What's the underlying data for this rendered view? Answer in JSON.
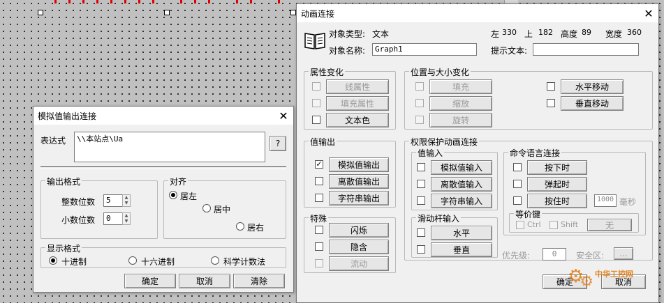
{
  "anim": {
    "title": "动画连接",
    "obj_type_label": "对象类型:",
    "obj_type": "文本",
    "left_label": "左",
    "left": "330",
    "top_label": "上",
    "top": "182",
    "height_label": "高度",
    "height": "89",
    "width_label": "宽度",
    "width": "360",
    "obj_name_label": "对象名称:",
    "obj_name": "Graph1",
    "hint_label": "提示文本:",
    "hint": "",
    "attr_group": "属性变化",
    "line_attr": "线属性",
    "fill_attr": "填充属性",
    "text_color": "文本色",
    "pos_group": "位置与大小变化",
    "fill": "填充",
    "scale": "缩放",
    "rotate": "旋转",
    "hmove": "水平移动",
    "vmove": "垂直移动",
    "valout_group": "值输出",
    "analog_out": "模拟值输出",
    "discrete_out": "离散值输出",
    "string_out": "字符串输出",
    "perm_group": "权限保护动画连接",
    "valin_group": "值输入",
    "analog_in": "模拟值输入",
    "discrete_in": "离散值输入",
    "string_in": "字符串输入",
    "slider_group": "滑动杆输入",
    "horizontal": "水平",
    "vertical": "垂直",
    "special_group": "特殊",
    "blink": "闪烁",
    "hide": "隐含",
    "flow": "流动",
    "cmd_group": "命令语言连接",
    "press": "按下时",
    "release": "弹起时",
    "hold": "按住时",
    "hold_value": "1000",
    "ms": "毫秒",
    "equiv_group": "等价键",
    "ctrl": "Ctrl",
    "shift": "Shift",
    "none": "无",
    "priority_label": "优先级:",
    "priority": "0",
    "security_label": "安全区:",
    "security_btn": "...",
    "ok": "确定",
    "cancel": "取消",
    "watermark": "中华工控网"
  },
  "analog": {
    "title": "模拟值输出连接",
    "expr_label": "表达式",
    "expr": "\\\\本站点\\Ua",
    "q": "?",
    "out_fmt": "输出格式",
    "int_label": "整数位数",
    "int_val": "5",
    "dec_label": "小数位数",
    "dec_val": "0",
    "align": "对齐",
    "left": "居左",
    "center": "居中",
    "right": "居右",
    "disp_fmt": "显示格式",
    "decimal": "十进制",
    "hex": "十六进制",
    "sci": "科学计数法",
    "ok": "确定",
    "cancel": "取消",
    "clear": "清除"
  },
  "colors": {
    "accent_red": "#e00000",
    "watermark": "#e07a10"
  }
}
